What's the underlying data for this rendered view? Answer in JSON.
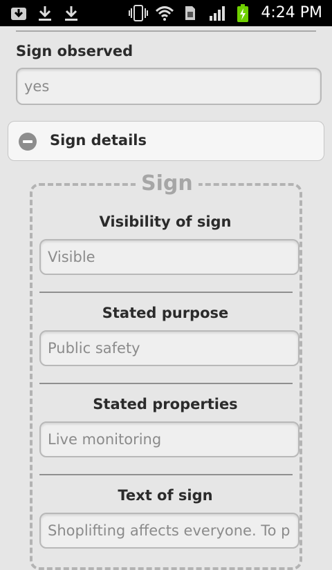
{
  "status_bar": {
    "time": "4:24 PM",
    "icons": [
      "download-tray-icon",
      "download-icon",
      "download-icon",
      "vibrate-icon",
      "wifi-icon",
      "sd-card-icon",
      "signal-icon",
      "battery-charging-icon"
    ],
    "battery_color": "#6fd100"
  },
  "form": {
    "sign_observed": {
      "label": "Sign observed",
      "value": "yes"
    },
    "section": {
      "title": "Sign details",
      "expanded": true
    },
    "group": {
      "legend": "Sign",
      "fields": [
        {
          "label": "Visibility of sign",
          "value": "Visible"
        },
        {
          "label": "Stated purpose",
          "value": "Public safety"
        },
        {
          "label": "Stated properties",
          "value": "Live monitoring"
        },
        {
          "label": "Text of sign",
          "value": "Shoplifting affects everyone. To p"
        }
      ]
    }
  }
}
